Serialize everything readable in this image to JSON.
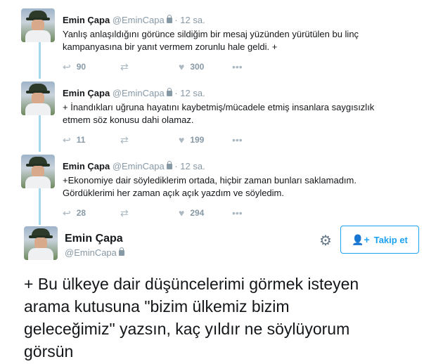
{
  "thread": [
    {
      "name": "Emin Çapa",
      "handle": "@EminCapa",
      "time": "· 12 sa.",
      "text_lines": [
        "Yanlış anlaşıldığını görünce sildiğim bir mesaj yüzünden yürütülen bu linç",
        "kampanyasına bir yanıt vermem zorunlu hale geldi.  +"
      ],
      "replies": "90",
      "likes": "300"
    },
    {
      "name": "Emin Çapa",
      "handle": "@EminCapa",
      "time": "· 12 sa.",
      "text_lines": [
        "+ İnandıkları uğruna hayatını kaybetmiş/mücadele etmiş insanlara saygısızlık",
        "etmem söz konusu dahi olamaz."
      ],
      "replies": "11",
      "likes": "199"
    },
    {
      "name": "Emin Çapa",
      "handle": "@EminCapa",
      "time": "· 12 sa.",
      "text_lines": [
        "+Ekonomiye dair söylediklerim ortada, hiçbir zaman bunları saklamadım.",
        "Gördüklerimi her zaman açık açık yazdım ve söyledim."
      ],
      "replies": "28",
      "likes": "294"
    }
  ],
  "main": {
    "name": "Emin Çapa",
    "handle": "@EminCapa",
    "follow_label": "Takip et",
    "text_lines": [
      "+ Bu ülkeye dair düşüncelerimi görmek isteyen",
      "arama kutusuna \"bizim ülkemiz bizim",
      "geleceğimiz\" yazsın, kaç yıldır ne söylüyorum",
      "görsün"
    ]
  },
  "icons": {
    "reply": "reply-icon",
    "retweet": "retweet-icon",
    "like": "heart-icon",
    "more": "more-icon",
    "gear": "gear-icon",
    "follow": "add-user-icon",
    "lock": "lock-icon"
  },
  "colors": {
    "accent": "#1da1f2",
    "thread_line": "#a5d8ee",
    "muted": "#8899a6"
  }
}
